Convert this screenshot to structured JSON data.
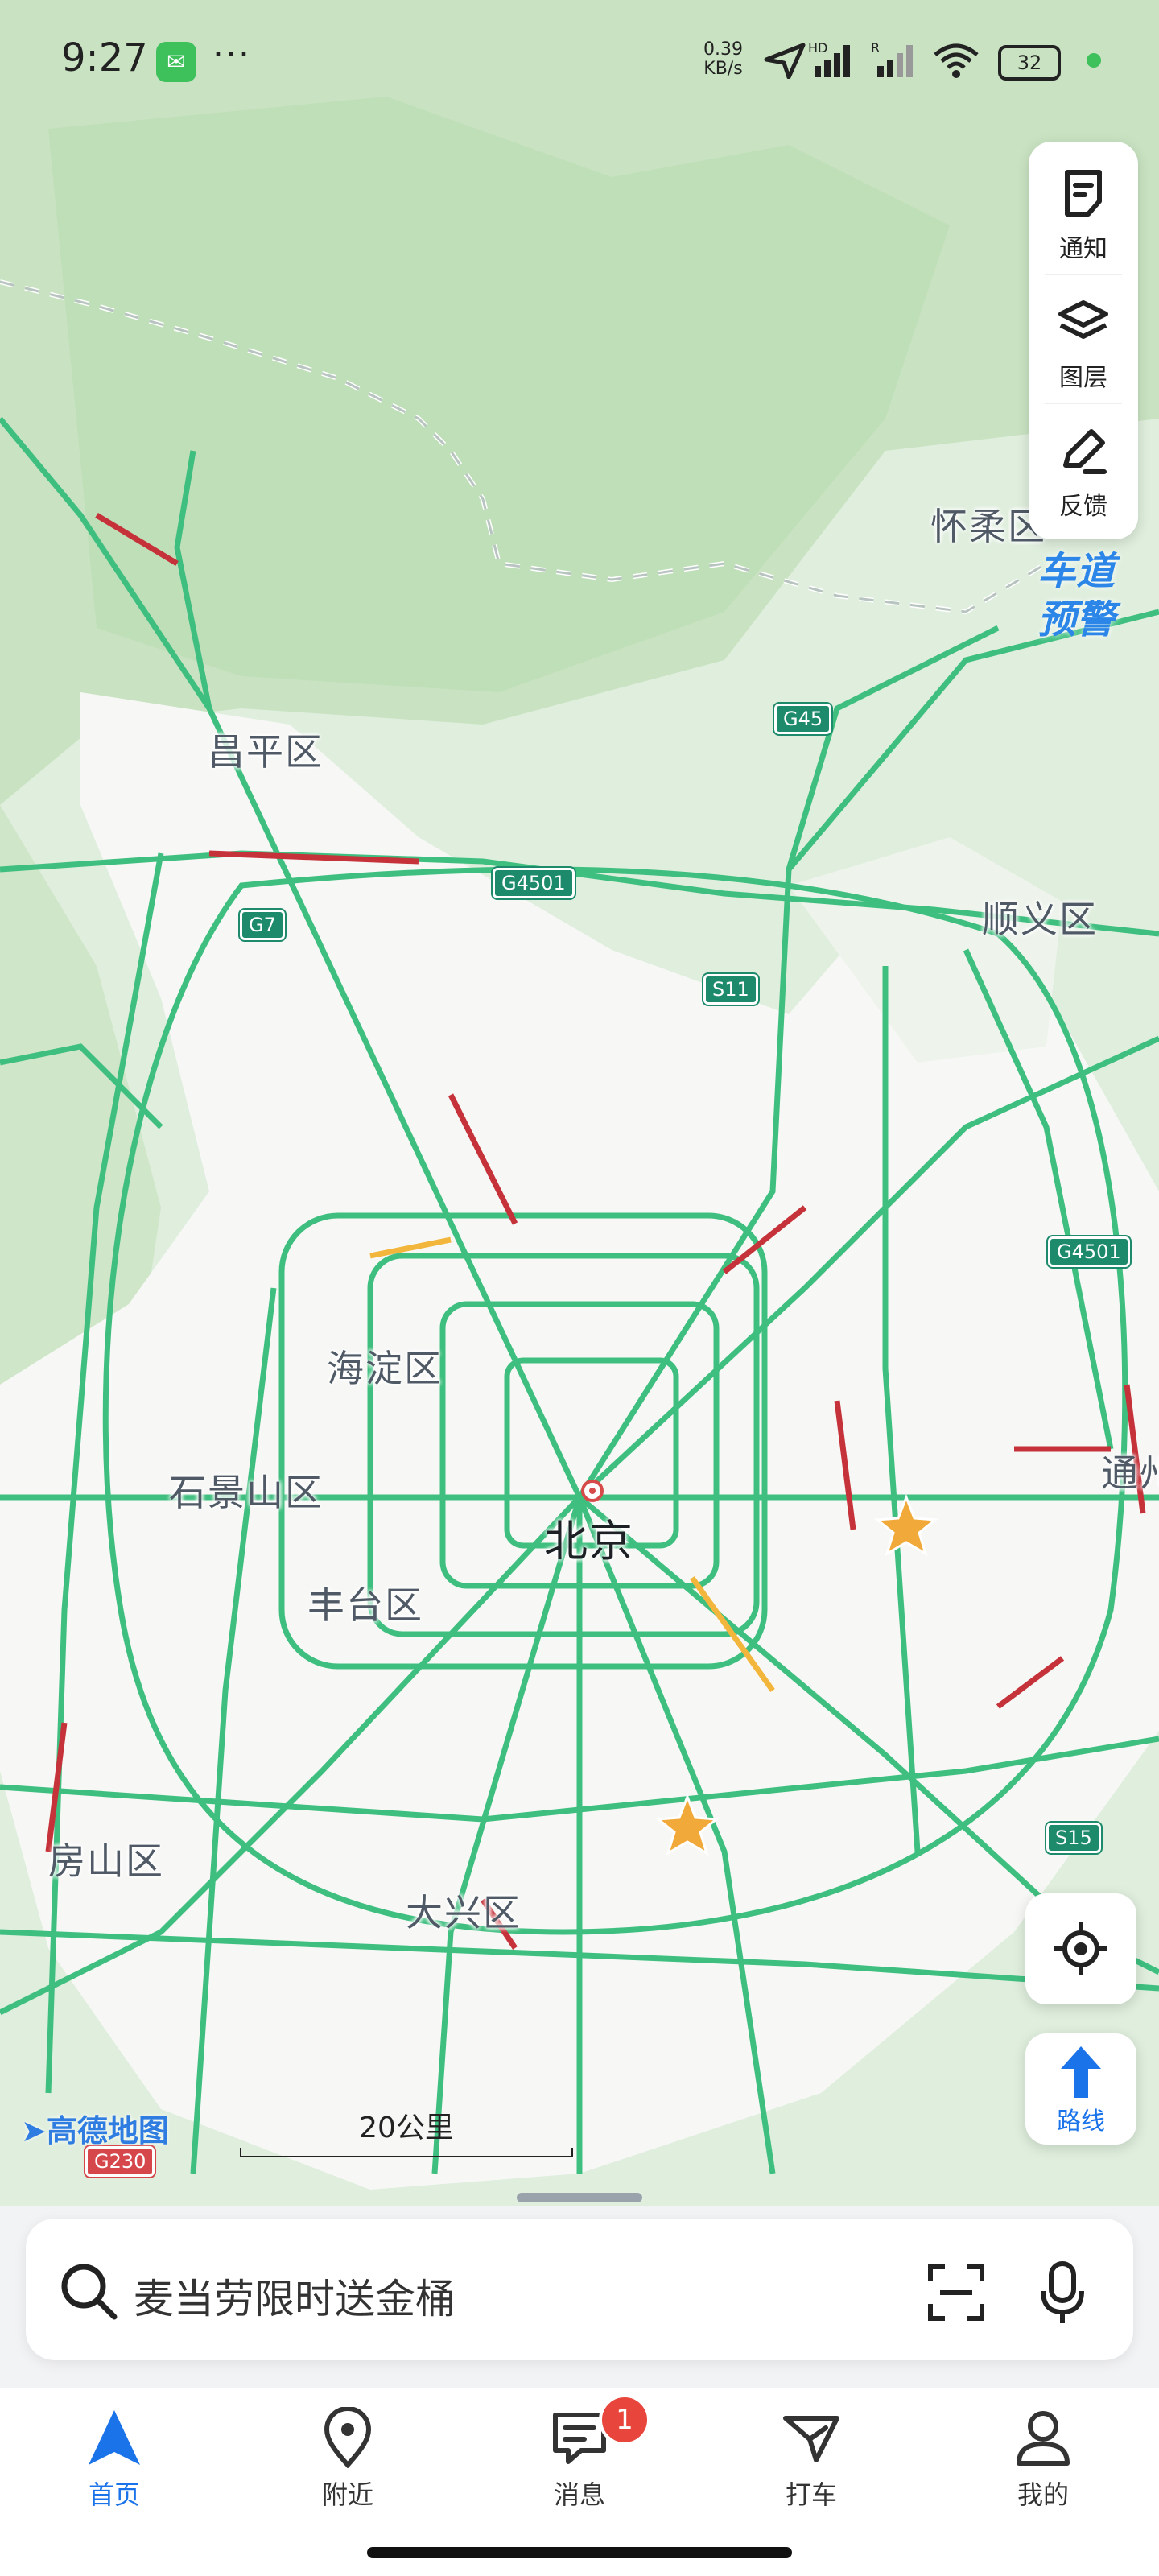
{
  "status_bar": {
    "time": "9:27",
    "more": "···",
    "net_speed_value": "0.39",
    "net_speed_unit": "KB/s",
    "sim1_label": "HD",
    "sim2_label": "R",
    "battery": "32"
  },
  "map": {
    "city": "北京",
    "districts": {
      "huairou": "怀柔区",
      "changping": "昌平区",
      "shunyi": "顺义区",
      "haidian": "海淀区",
      "shijingshan": "石景山区",
      "fengtai": "丰台区",
      "fangshan": "房山区",
      "daxing": "大兴区",
      "tongzhou": "通州"
    },
    "shields": {
      "g45": "G45",
      "g4501_north": "G4501",
      "g7": "G7",
      "s11": "S11",
      "g4501_east": "G4501",
      "s15": "S15",
      "g230": "G230"
    },
    "colors": {
      "road_clear": "#3fbf7f",
      "road_slow": "#f2b63c",
      "road_jam": "#c6323a",
      "urban": "#f7f8f6",
      "forest": "#cfe6c9"
    },
    "logo": "高德地图",
    "scale_label": "20公里"
  },
  "right_panel": {
    "notice_label": "通知",
    "layers_label": "图层",
    "feedback_label": "反馈"
  },
  "lane_warning": {
    "line1": "车道",
    "line2": "预警"
  },
  "route_button": {
    "label": "路线"
  },
  "search": {
    "placeholder": "麦当劳限时送金桶"
  },
  "tabs": [
    {
      "label": "首页",
      "icon": "navigation-arrow-icon"
    },
    {
      "label": "附近",
      "icon": "location-pin-icon"
    },
    {
      "label": "消息",
      "icon": "chat-icon"
    },
    {
      "label": "打车",
      "icon": "taxi-icon"
    },
    {
      "label": "我的",
      "icon": "user-icon"
    }
  ],
  "messages_badge": "1"
}
